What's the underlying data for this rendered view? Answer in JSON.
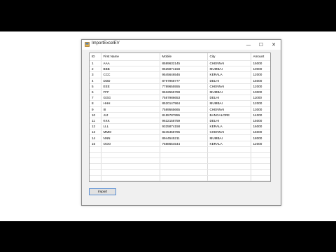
{
  "window": {
    "title": "ImportExcelEV"
  },
  "titlebar_controls": {
    "minimize": "—",
    "maximize": "☐",
    "close": "✕"
  },
  "grid": {
    "columns": [
      "ID",
      "First Name",
      "Mobile",
      "City",
      "Amount"
    ],
    "rows": [
      [
        "1",
        "AAA",
        "8589632145",
        "CHENNAI",
        "15000"
      ],
      [
        "2",
        "BBB",
        "9625874158",
        "MUMBAI",
        "10000"
      ],
      [
        "3",
        "CCC",
        "9545646546",
        "KERALA",
        "12000"
      ],
      [
        "4",
        "DDD",
        "8797968777",
        "DELHI",
        "15000"
      ],
      [
        "5",
        "EEE",
        "7789655555",
        "CHENNAI",
        "12000"
      ],
      [
        "6",
        "FFF",
        "9632555788",
        "MUMBAI",
        "10000"
      ],
      [
        "7",
        "GGG",
        "7587986653",
        "DELHI",
        "11000"
      ],
      [
        "8",
        "HHH",
        "8520147964",
        "MUMBAI",
        "12000"
      ],
      [
        "9",
        "III",
        "7589565665",
        "CHENNAI",
        "13000"
      ],
      [
        "10",
        "JJJ",
        "8155787855",
        "BANGALORE",
        "14000"
      ],
      [
        "11",
        "KKK",
        "9632158759",
        "DELHI",
        "15000"
      ],
      [
        "12",
        "LLL",
        "9325874158",
        "KERALA",
        "16000"
      ],
      [
        "13",
        "MMM",
        "8245458785",
        "CHENNAI",
        "15000"
      ],
      [
        "14",
        "NNN",
        "8944545211",
        "MUMBAI",
        "18000"
      ],
      [
        "15",
        "OOO",
        "7588654544",
        "KERALA",
        "12000"
      ]
    ]
  },
  "import_button": {
    "label": "Import"
  }
}
